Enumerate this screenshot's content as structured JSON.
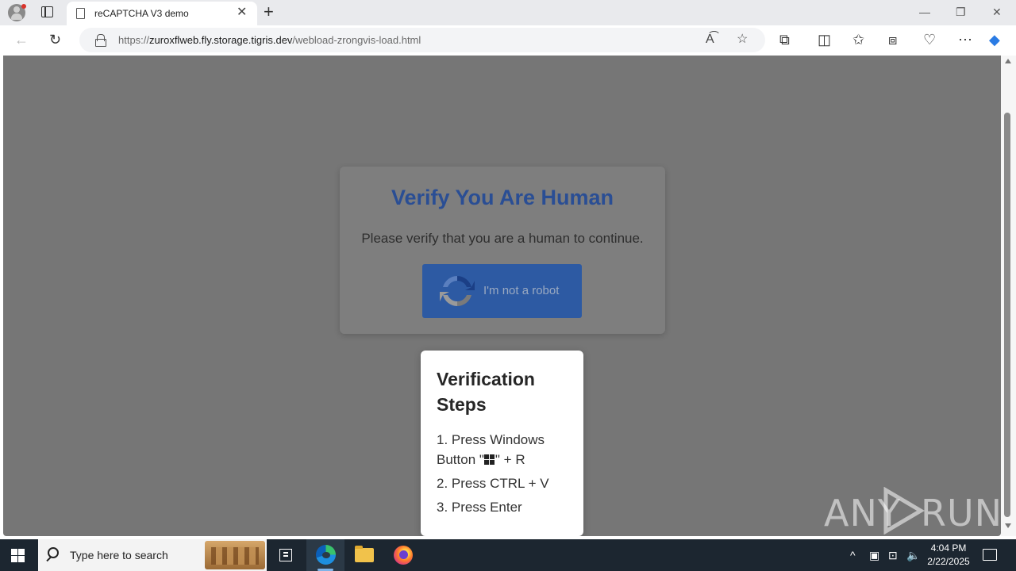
{
  "browser": {
    "tab_title": "reCAPTCHA V3 demo",
    "url_prefix": "https://",
    "url_host": "zuroxflweb.fly.storage.tigris.dev",
    "url_path": "/webload-zrongvis-load.html"
  },
  "page": {
    "card": {
      "title": "Verify You Are Human",
      "text": "Please verify that you are a human to continue.",
      "button_label": "I'm not a robot"
    },
    "steps": {
      "title": "Verification Steps",
      "step1_before": "1. Press Windows Button \"",
      "step1_after": "\" + R",
      "step2": "2. Press CTRL + V",
      "step3": "3. Press Enter"
    },
    "watermark": {
      "left": "ANY",
      "right": "RUN"
    }
  },
  "taskbar": {
    "search_placeholder": "Type here to search",
    "time": "4:04 PM",
    "date": "2/22/2025"
  },
  "colors": {
    "card_title": "#2a4e94",
    "robot_button": "#2d5aa3",
    "page_overlay": "#767676",
    "taskbar": "#1c2630"
  }
}
